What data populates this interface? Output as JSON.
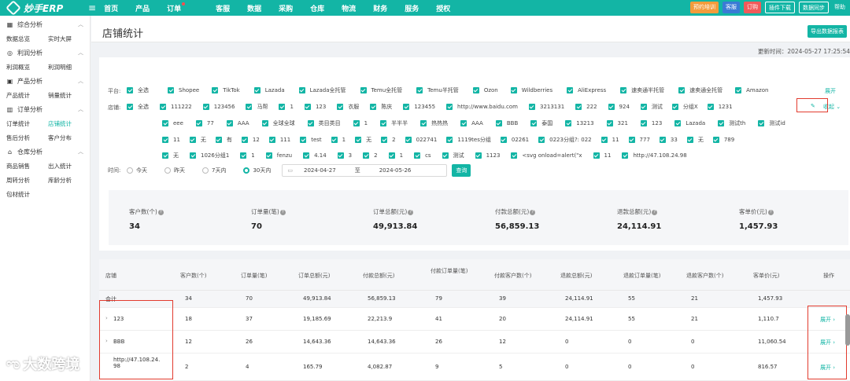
{
  "header": {
    "logo": "妙手ERP",
    "nav": [
      "首页",
      "产品",
      "订单",
      "客服",
      "数据",
      "采购",
      "仓库",
      "物流",
      "财务",
      "服务",
      "授权"
    ],
    "buttons": {
      "training": "预约培训",
      "service": "客服",
      "subscribe": "订购",
      "plugin": "插件下载",
      "sync": "数据同步",
      "help": "帮助"
    }
  },
  "sidebar": {
    "groups": [
      {
        "title": "综合分析",
        "icon": "grid-icon",
        "items": [
          "数据总览",
          "实时大屏"
        ]
      },
      {
        "title": "利润分析",
        "icon": "coin-icon",
        "items": [
          "利润概览",
          "利润明细"
        ]
      },
      {
        "title": "产品分析",
        "icon": "box-icon",
        "items": [
          "产品统计",
          "销量统计"
        ]
      },
      {
        "title": "订单分析",
        "icon": "chart-icon",
        "items": [
          "订单统计",
          "店铺统计",
          "售后分析",
          "客户分布"
        ]
      },
      {
        "title": "仓库分析",
        "icon": "warehouse-icon",
        "items": [
          "商品销售",
          "出入统计",
          "周转分析",
          "库龄分析",
          "包材统计"
        ]
      }
    ],
    "active": "店铺统计"
  },
  "page": {
    "title": "店铺统计",
    "export_label": "导出数据报表",
    "update_time": "更新时间：2024-05-27 17:25:54"
  },
  "filters": {
    "platform_label": "平台:",
    "platforms": [
      "全选",
      "Shopee",
      "TikTok",
      "Lazada",
      "Lazada全托管",
      "Temu全托管",
      "Temu半托管",
      "Ozon",
      "Wildberries",
      "AliExpress",
      "速卖通半托管",
      "速卖通全托管",
      "Amazon"
    ],
    "expand_label": "展开",
    "store_label": "店铺:",
    "stores_row1": [
      "全选",
      "111222",
      "123456",
      "马帮",
      "1",
      "123",
      "衣服",
      "陈庆",
      "123455",
      "http://www.baidu.com",
      "3213131",
      "222",
      "924",
      "测试",
      "分组X",
      "1231"
    ],
    "stores_row2": [
      "eee",
      "77",
      "AAA",
      "全球全球",
      "类目类目",
      "1",
      "半半半",
      "热热热",
      "AAA",
      "BBB",
      "泰国",
      "13213",
      "321",
      "123",
      "Lazada",
      "测试th",
      "测试id"
    ],
    "stores_row3": [
      "11",
      "无",
      "有",
      "12",
      "111",
      "test",
      "1",
      "无",
      "2",
      "022741",
      "1119tes分组",
      "02261",
      "0223分组?: 022",
      "11",
      "777",
      "33",
      "无",
      "789"
    ],
    "stores_row4": [
      "无",
      "1026分组1",
      "1",
      "fenzu",
      "4.14",
      "3",
      "2",
      "1",
      "cs",
      "测试",
      "1123",
      "<svg onload=alert(\"x",
      "11",
      "http://47.108.24.98"
    ],
    "collapse_label": "收起",
    "time_label": "时间:",
    "time_options": [
      "今天",
      "昨天",
      "7天内",
      "30天内"
    ],
    "time_selected": "30天内",
    "date_start": "2024-04-27",
    "date_to": "至",
    "date_end": "2024-05-26",
    "query_label": "查询"
  },
  "stats": [
    {
      "label": "客户数(个)",
      "value": "34"
    },
    {
      "label": "订单量(笔)",
      "value": "70"
    },
    {
      "label": "订单总额(元)",
      "value": "49,913.84"
    },
    {
      "label": "付款总额(元)",
      "value": "56,859.13"
    },
    {
      "label": "退款总额(元)",
      "value": "24,114.91"
    },
    {
      "label": "客单价(元)",
      "value": "1,457.93"
    }
  ],
  "table": {
    "columns": [
      "店铺",
      "客户数(个)",
      "订单量(笔)",
      "订单总额(元)",
      "付款总额(元)",
      "付款订单量(笔)",
      "付款客户数(个)",
      "退款总额(元)",
      "退款订单量(笔)",
      "退款客户数(个)",
      "客单价(元)",
      "操作"
    ],
    "total": [
      "合计",
      "34",
      "70",
      "49,913.84",
      "56,859.13",
      "79",
      "39",
      "24,114.91",
      "55",
      "21",
      "1,457.93"
    ],
    "rows": [
      [
        "123",
        "18",
        "37",
        "19,185.69",
        "22,213.9",
        "41",
        "20",
        "24,114.91",
        "55",
        "21",
        "1,110.7"
      ],
      [
        "BBB",
        "12",
        "26",
        "14,643.36",
        "14,643.36",
        "26",
        "12",
        "0",
        "0",
        "0",
        "11,060.54"
      ],
      [
        "http://47.108.24.98",
        "2",
        "4",
        "165.79",
        "4,082.87",
        "9",
        "5",
        "0",
        "0",
        "0",
        "816.57"
      ]
    ],
    "expand_label": "展开"
  },
  "watermark": "大数跨境"
}
